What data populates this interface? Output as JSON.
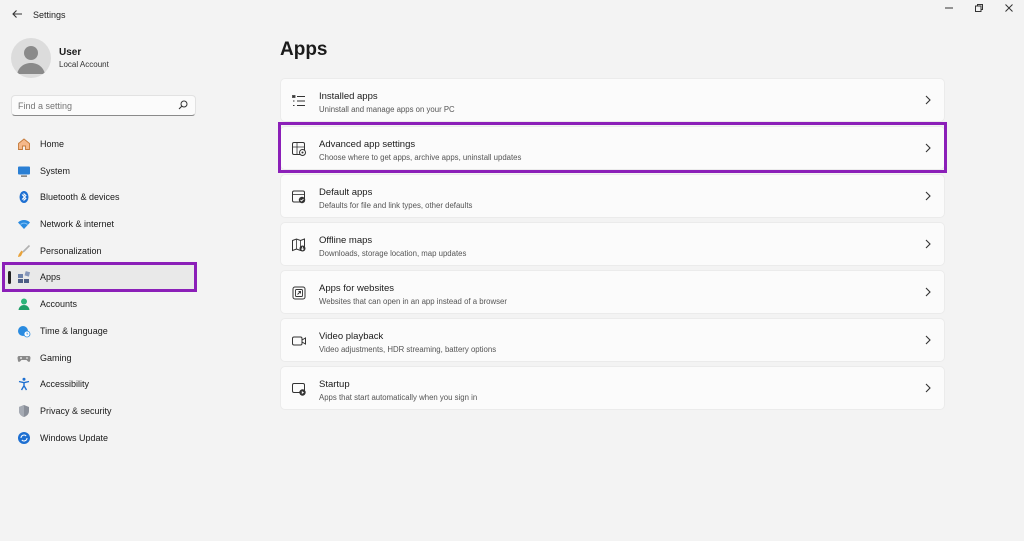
{
  "window": {
    "title": "Settings"
  },
  "profile": {
    "name": "User",
    "account_type": "Local Account"
  },
  "search": {
    "placeholder": "Find a setting"
  },
  "nav": {
    "items": [
      {
        "label": "Home",
        "icon": "home-icon"
      },
      {
        "label": "System",
        "icon": "system-icon"
      },
      {
        "label": "Bluetooth & devices",
        "icon": "bluetooth-icon"
      },
      {
        "label": "Network & internet",
        "icon": "wifi-icon"
      },
      {
        "label": "Personalization",
        "icon": "brush-icon"
      },
      {
        "label": "Apps",
        "icon": "apps-icon",
        "active": true
      },
      {
        "label": "Accounts",
        "icon": "accounts-icon"
      },
      {
        "label": "Time & language",
        "icon": "globe-clock-icon"
      },
      {
        "label": "Gaming",
        "icon": "gamepad-icon"
      },
      {
        "label": "Accessibility",
        "icon": "accessibility-icon"
      },
      {
        "label": "Privacy & security",
        "icon": "shield-icon"
      },
      {
        "label": "Windows Update",
        "icon": "update-icon"
      }
    ]
  },
  "main": {
    "title": "Apps",
    "cards": [
      {
        "title": "Installed apps",
        "desc": "Uninstall and manage apps on your PC",
        "icon": "list-icon"
      },
      {
        "title": "Advanced app settings",
        "desc": "Choose where to get apps, archive apps, uninstall updates",
        "icon": "app-settings-icon"
      },
      {
        "title": "Default apps",
        "desc": "Defaults for file and link types, other defaults",
        "icon": "default-apps-icon"
      },
      {
        "title": "Offline maps",
        "desc": "Downloads, storage location, map updates",
        "icon": "map-icon"
      },
      {
        "title": "Apps for websites",
        "desc": "Websites that can open in an app instead of a browser",
        "icon": "open-external-icon"
      },
      {
        "title": "Video playback",
        "desc": "Video adjustments, HDR streaming, battery options",
        "icon": "video-icon"
      },
      {
        "title": "Startup",
        "desc": "Apps that start automatically when you sign in",
        "icon": "startup-icon"
      }
    ]
  },
  "colors": {
    "highlight": "#8b1fb8",
    "background": "#f3f3f3",
    "card": "#fbfbfb"
  }
}
